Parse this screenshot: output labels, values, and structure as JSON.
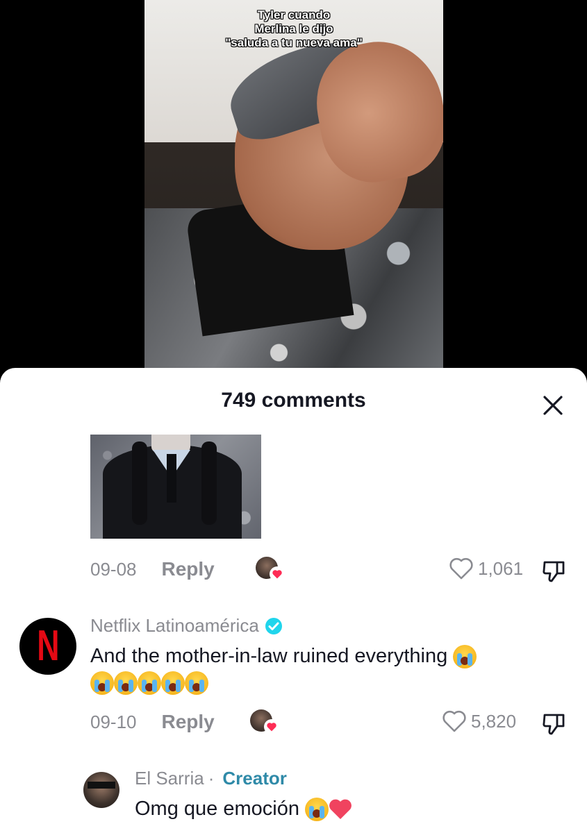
{
  "video": {
    "caption_lines": [
      "Tyler cuando",
      "Merlina le dijo",
      "\"saluda a tu nueva ama\""
    ]
  },
  "sheet": {
    "title": "749 comments",
    "close_icon": "close-icon"
  },
  "comments": [
    {
      "has_image": true,
      "date": "09-08",
      "reply_label": "Reply",
      "creator_liked": true,
      "likes": "1,061"
    },
    {
      "username": "Netflix Latinoamérica",
      "verified": true,
      "text": "And the mother-in-law ruined everything",
      "emoji_count_line2": 5,
      "date": "09-10",
      "reply_label": "Reply",
      "creator_liked": true,
      "likes": "5,820"
    },
    {
      "username": "El Sarria",
      "separator": "·",
      "badge": "Creator",
      "text": "Omg que emoción",
      "colors": {
        "creator_badge": "#2f8aa8"
      }
    }
  ],
  "colors": {
    "text_primary": "#161823",
    "text_secondary": "#8a8b91",
    "netflix_red": "#e50914",
    "heart_red": "#fe2c55",
    "verified_blue": "#20d5ec"
  }
}
